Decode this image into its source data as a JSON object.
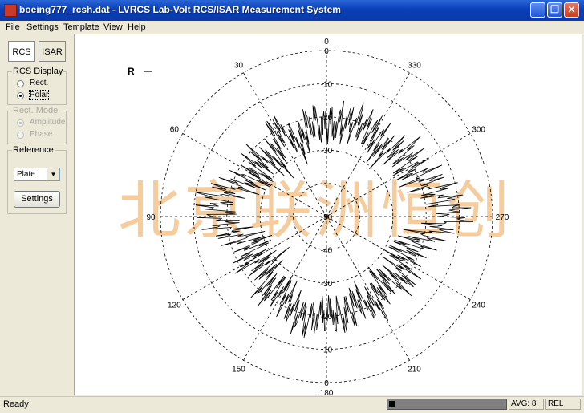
{
  "window": {
    "title": "boeing777_rcsh.dat - LVRCS Lab-Volt RCS/ISAR Measurement System",
    "minimize": "_",
    "maximize": "❐",
    "close": "✕"
  },
  "menu": [
    "File",
    "Settings",
    "Template",
    "View",
    "Help"
  ],
  "tabs": {
    "rcs": "RCS",
    "isar": "ISAR"
  },
  "rcs_display": {
    "title": "RCS Display",
    "options": [
      "Rect.",
      "Polar"
    ],
    "selected": "Polar"
  },
  "rect_mode": {
    "title": "Rect. Mode",
    "options": [
      "Amplitude",
      "Phase"
    ],
    "selected": "Amplitude",
    "enabled": false
  },
  "reference": {
    "title": "Reference",
    "selected": "Plate",
    "dropdown_arrow": "▼",
    "settings_button": "Settings"
  },
  "plot": {
    "legend_label": "R",
    "angle_labels": [
      "0",
      "30",
      "60",
      "90",
      "120",
      "150",
      "180",
      "210",
      "240",
      "270",
      "300",
      "330"
    ],
    "radial_labels_top": [
      "0",
      "-10",
      "-20",
      "-30"
    ],
    "radial_labels_bottom": [
      "-40",
      "-30",
      "-20",
      "-10",
      "0"
    ],
    "center_label": "-50",
    "watermark": "北京联洲恒创"
  },
  "chart_data": {
    "type": "polar",
    "angle_direction": "counter-clockwise, 0 at top",
    "r_range_db": [
      -50,
      0
    ],
    "r_ticks": [
      0,
      -10,
      -20,
      -30,
      -40,
      -50
    ],
    "angle_ticks_deg": [
      0,
      30,
      60,
      90,
      120,
      150,
      180,
      210,
      240,
      270,
      300,
      330
    ],
    "grid": true,
    "series": [
      {
        "name": "R",
        "color": "#000000",
        "angle_deg": [
          0,
          10,
          20,
          30,
          40,
          50,
          60,
          70,
          80,
          90,
          100,
          110,
          120,
          130,
          140,
          150,
          160,
          170,
          180,
          190,
          200,
          210,
          220,
          230,
          240,
          250,
          260,
          270,
          280,
          290,
          300,
          310,
          320,
          330,
          340,
          350
        ],
        "rcs_db": [
          -22,
          -20,
          -26,
          -18,
          -27,
          -22,
          -25,
          -21,
          -15,
          -16,
          -20,
          -26,
          -22,
          -27,
          -20,
          -23,
          -19,
          -17,
          -20,
          -18,
          -22,
          -18,
          -24,
          -19,
          -23,
          -22,
          -18,
          -10,
          -14,
          -17,
          -20,
          -18,
          -23,
          -20,
          -19,
          -20
        ]
      }
    ]
  },
  "status": {
    "text": "Ready",
    "progress": 0.05,
    "avg": "AVG: 8",
    "mode": "REL"
  },
  "colors": {
    "title_bar": "#0a3fb8",
    "panel": "#ece9d8",
    "watermark": "#f3c48e"
  }
}
